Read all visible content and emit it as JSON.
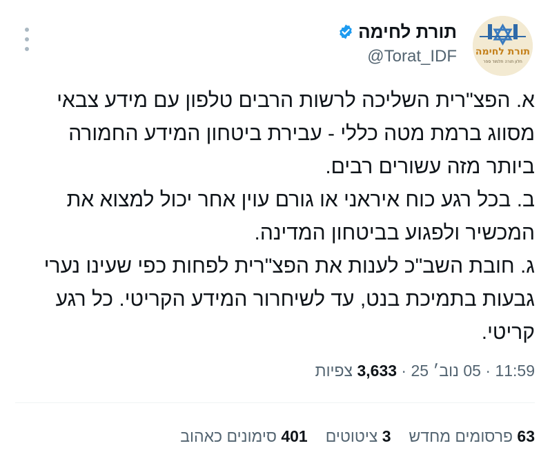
{
  "author": {
    "display_name": "תורת לחימה",
    "handle": "@Torat_IDF",
    "avatar_text": "תורת לחימה",
    "avatar_subtext": "חלון תורה תלמוד ספר",
    "verified_color": "#1d9bf0"
  },
  "tweet": {
    "lines": [
      "א. הפצ\"רית השליכה לרשות הרבים טלפון עם מידע צבאי",
      "מסווג ברמת מטה כללי - עבירת ביטחון המידע החמורה",
      "ביותר מזה עשורים רבים.",
      "ב. בכל רגע כוח איראני או גורם עוין אחר יכול למצוא את",
      "המכשיר ולפגוע בביטחון המדינה.",
      "ג. חובת השב\"כ לענות את הפצ\"רית לפחות כפי שעינו נערי",
      "גבעות בתמיכת בנט, עד לשיחרור המידע הקריטי. כל רגע",
      "קריטי."
    ]
  },
  "meta": {
    "time": "11:59",
    "date": "05 נוב׳ 25",
    "separator": "·",
    "views_count": "3,633",
    "views_label": "צפיות"
  },
  "stats": {
    "reposts_count": "63",
    "reposts_label": "פרסומים מחדש",
    "quotes_count": "3",
    "quotes_label": "ציטוטים",
    "likes_count": "401",
    "likes_label": "סימונים כאהוב"
  },
  "colors": {
    "text_primary": "#0f1419",
    "text_secondary": "#536471",
    "divider": "#eff3f4"
  }
}
